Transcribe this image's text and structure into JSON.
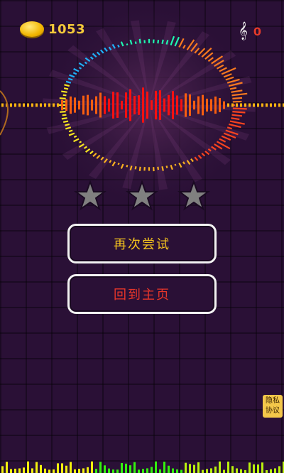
{
  "hud": {
    "coins": "1053",
    "notes": "0",
    "coin_icon": "gold-coin-icon",
    "note_icon": "treble-clef-icon"
  },
  "result": {
    "stars_total": 3,
    "stars_earned": 0
  },
  "buttons": {
    "retry": "再次尝试",
    "home": "回到主页"
  },
  "privacy": {
    "label_line1": "隐私",
    "label_line2": "协议"
  },
  "colors": {
    "coin_text": "#f4c93a",
    "retry_text": "#f4c21e",
    "home_text": "#e8362a",
    "note_count": "#e43a2a",
    "star_empty": "#808080",
    "background": "#2a1036"
  }
}
